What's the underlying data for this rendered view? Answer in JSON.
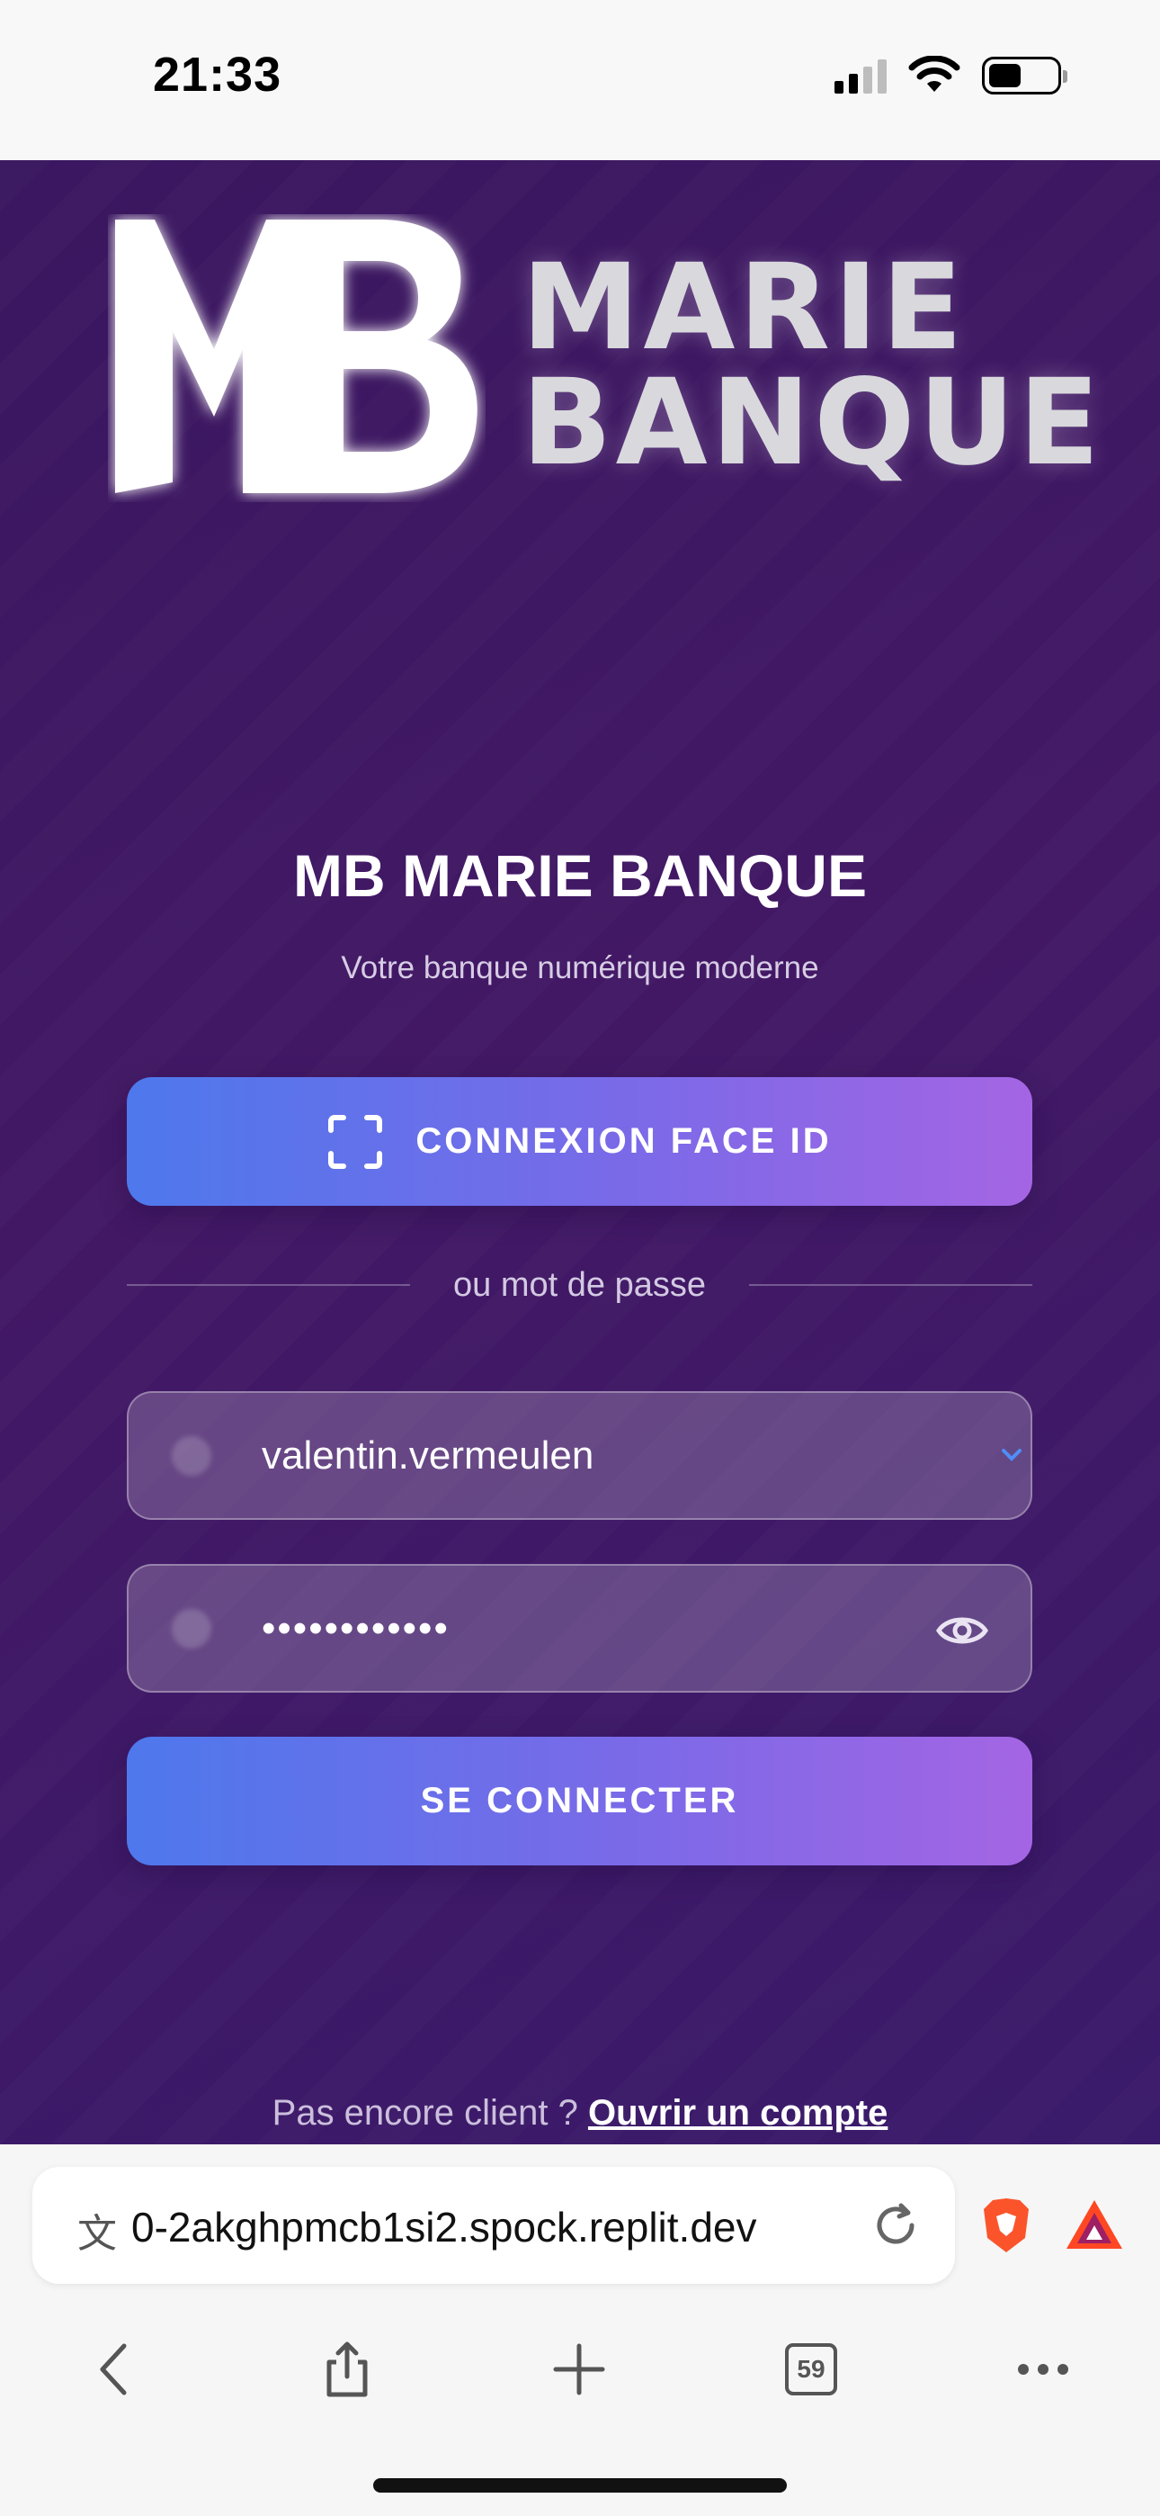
{
  "status_bar": {
    "time": "21:33"
  },
  "logo": {
    "line1": "MARIE",
    "line2": "BANQUE"
  },
  "login": {
    "title": "MB MARIE BANQUE",
    "subtitle": "Votre banque numérique moderne",
    "faceid_label": "CONNEXION FACE ID",
    "divider_text": "ou mot de passe",
    "username_value": "valentin.vermeulen",
    "password_mask": "••••••••••••",
    "connect_label": "SE CONNECTER",
    "footer_prompt": "Pas encore client ?",
    "footer_link": "Ouvrir un compte"
  },
  "browser": {
    "url": "0-2akghpmcb1si2.spock.replit.dev",
    "tab_count": "59"
  },
  "colors": {
    "background": "#421865",
    "button_start": "#4e78ec",
    "button_end": "#a465e4"
  }
}
